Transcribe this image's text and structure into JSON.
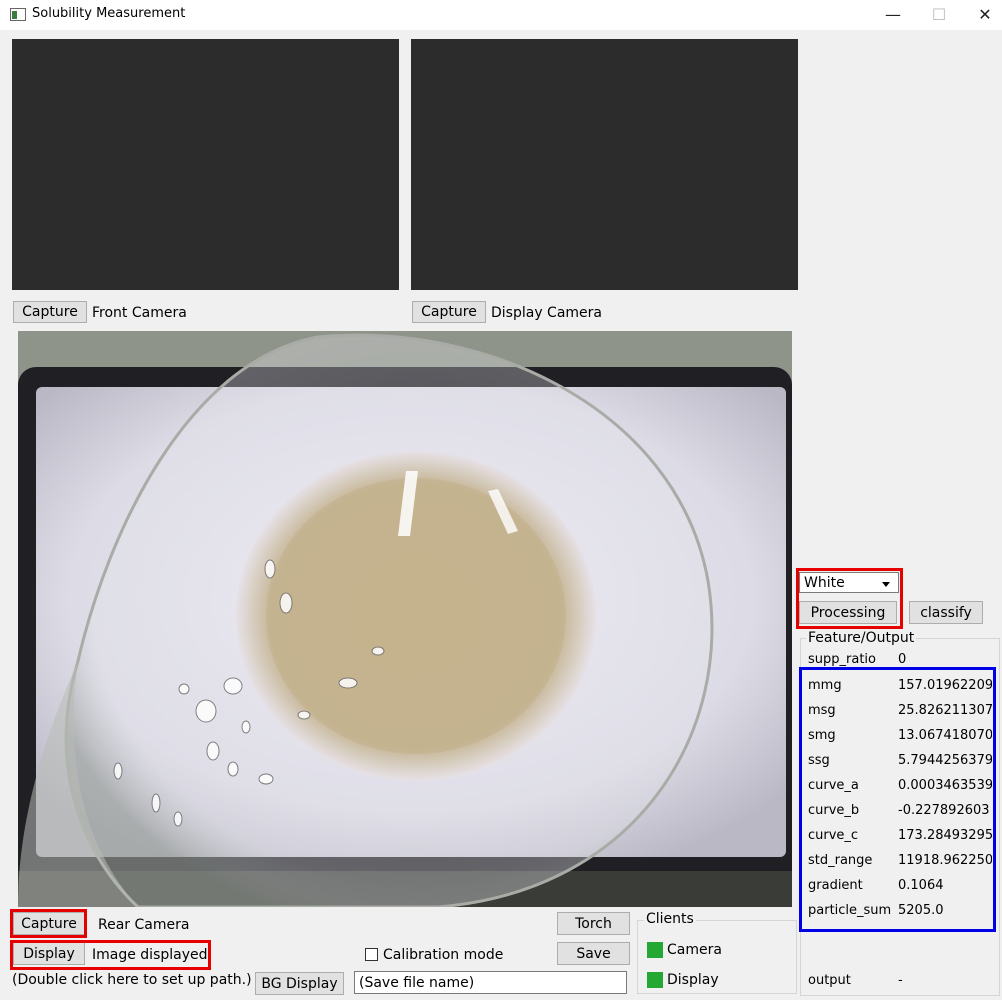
{
  "window": {
    "title": "Solubility Measurement",
    "minimize": "—",
    "maximize": "☐",
    "close": "✕"
  },
  "front": {
    "capture_label": "Capture",
    "camera_label": "Front Camera"
  },
  "display_cam": {
    "capture_label": "Capture",
    "camera_label": "Display Camera"
  },
  "rear": {
    "capture_label": "Capture",
    "camera_label": "Rear Camera",
    "display_label": "Display",
    "status": "Image displayed.",
    "path_hint": "(Double click here to set up path.)"
  },
  "controls": {
    "bg_display_label": "BG Display",
    "save_name_placeholder": "(Save file name)",
    "calibration_label": "Calibration mode",
    "calibration_checked": false,
    "torch_label": "Torch",
    "save_label": "Save"
  },
  "clients": {
    "title": "Clients",
    "items": [
      {
        "label": "Camera",
        "status_color": "#22a833"
      },
      {
        "label": "Display",
        "status_color": "#22a833"
      }
    ]
  },
  "processing": {
    "color_select": "White",
    "processing_label": "Processing",
    "classify_label": "classify"
  },
  "features": {
    "title": "Feature/Output",
    "supp_ratio": {
      "name": "supp_ratio",
      "value": "0"
    },
    "rows": [
      {
        "name": "mmg",
        "value": "157.01962209"
      },
      {
        "name": "msg",
        "value": "25.826211307"
      },
      {
        "name": "smg",
        "value": "13.067418070"
      },
      {
        "name": "ssg",
        "value": "5.7944256379"
      },
      {
        "name": "curve_a",
        "value": "0.0003463539"
      },
      {
        "name": "curve_b",
        "value": "-0.227892603"
      },
      {
        "name": "curve_c",
        "value": "173.28493295"
      },
      {
        "name": "std_range",
        "value": "11918.962250"
      },
      {
        "name": "gradient",
        "value": "0.1064"
      },
      {
        "name": "particle_sum",
        "value": "5205.0"
      }
    ],
    "output": {
      "name": "output",
      "value": "-"
    }
  },
  "colors": {
    "highlight_red": "#e60000",
    "highlight_blue": "#0000e6",
    "camera_empty": "#2c2c2c",
    "client_online": "#22a833"
  }
}
